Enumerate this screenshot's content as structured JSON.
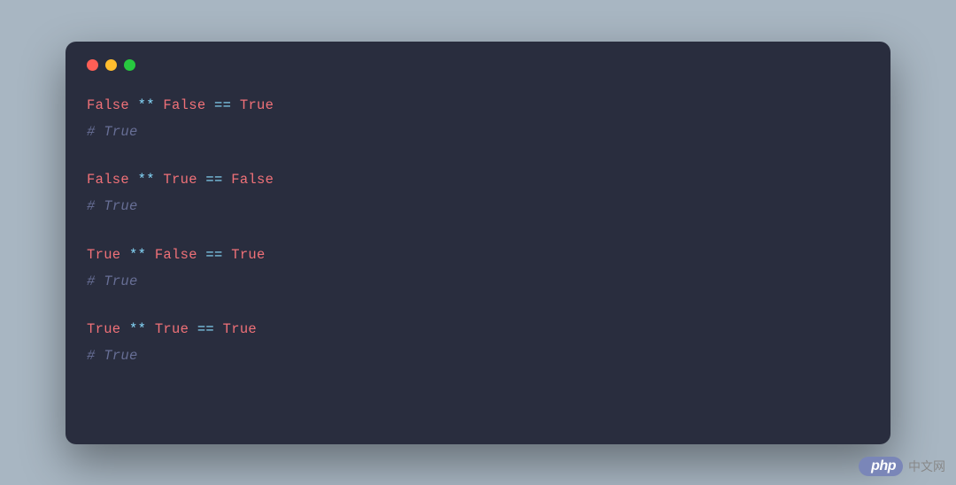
{
  "code": {
    "line1_false1": "False",
    "line1_op": " ** ",
    "line1_false2": "False",
    "line1_eq": " == ",
    "line1_true": "True",
    "line2_comment": "# True",
    "line3_false": "False",
    "line3_op": " ** ",
    "line3_true": "True",
    "line3_eq": " == ",
    "line3_false2": "False",
    "line4_comment": "# True",
    "line5_true": "True",
    "line5_op": " ** ",
    "line5_false": "False",
    "line5_eq": " == ",
    "line5_true2": "True",
    "line6_comment": "# True",
    "line7_true1": "True",
    "line7_op": " ** ",
    "line7_true2": "True",
    "line7_eq": " == ",
    "line7_true3": "True",
    "line8_comment": "# True"
  },
  "watermark": {
    "badge": "php",
    "text": "中文网"
  }
}
